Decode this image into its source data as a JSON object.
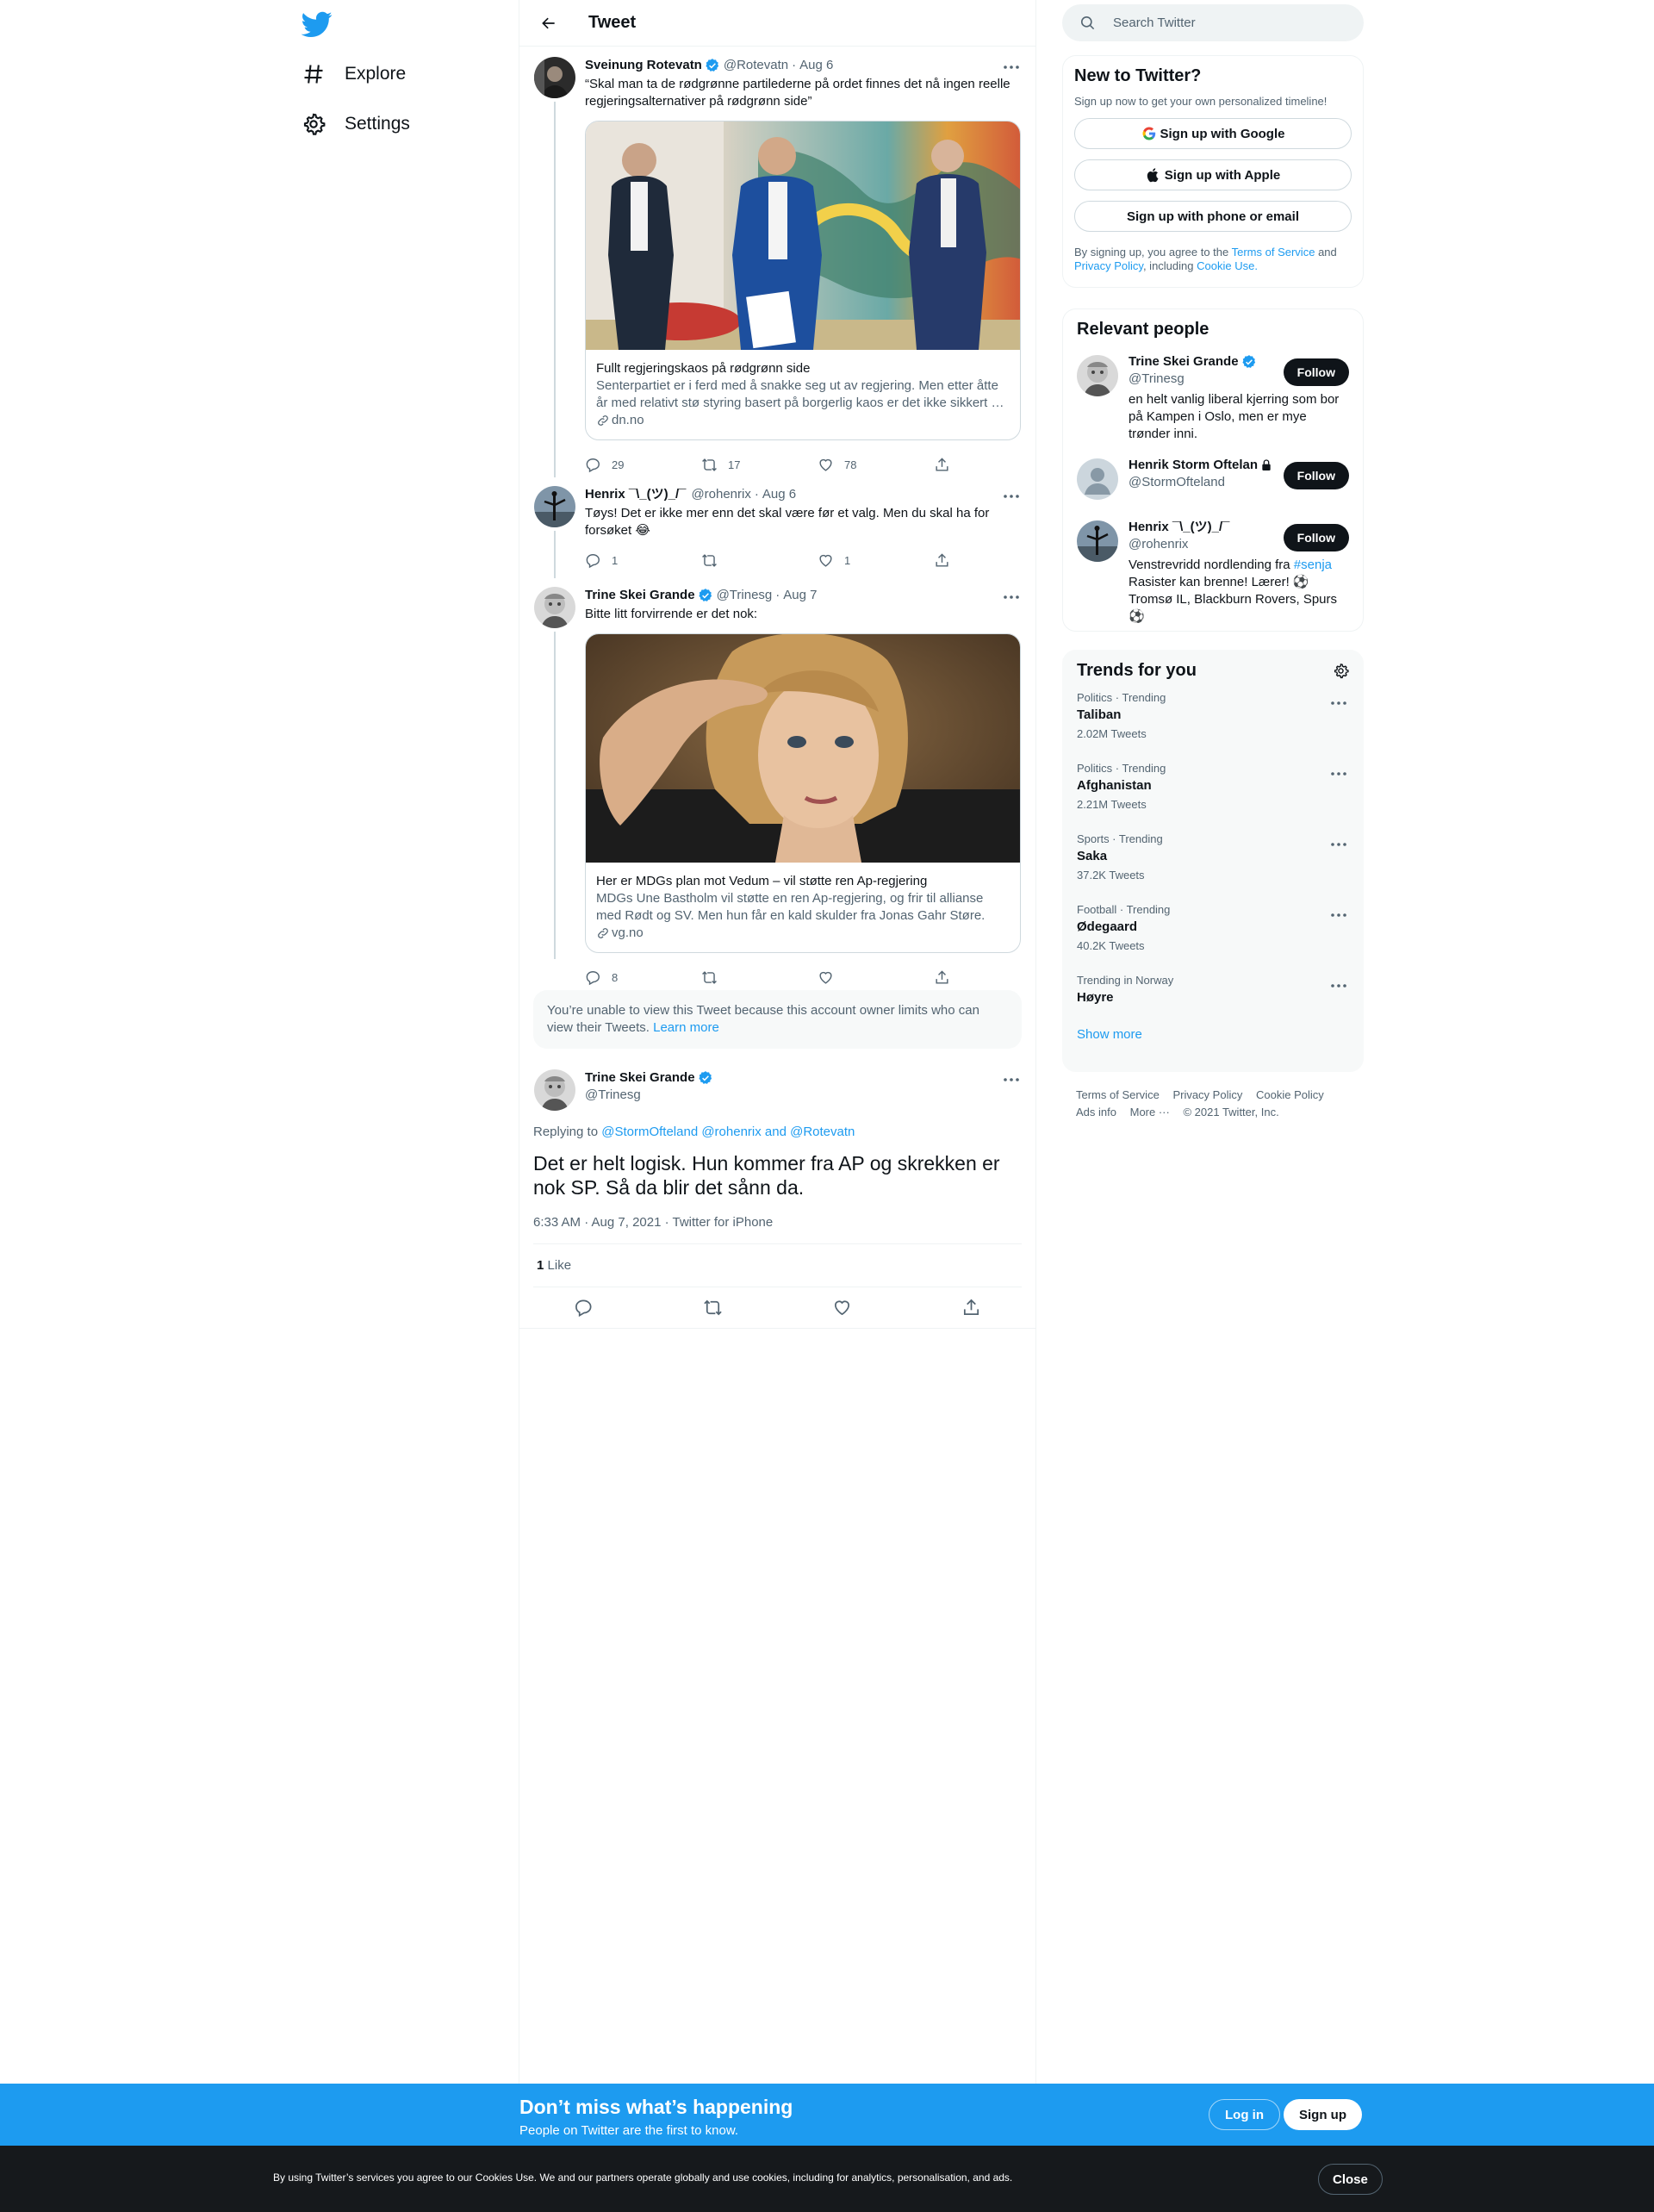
{
  "colors": {
    "accent": "#1d9bf0",
    "text": "#0f1419",
    "secondary": "#536471"
  },
  "nav": {
    "explore": "Explore",
    "settings": "Settings"
  },
  "header": {
    "title": "Tweet"
  },
  "tweets": [
    {
      "name": "Sveinung Rotevatn",
      "handle": "@Rotevatn",
      "sep": "·",
      "date": "Aug 6",
      "text": "“Skal man ta de rødgrønne partilederne på ordet finnes det nå ingen reelle regjeringsalternativer på rødgrønn side”",
      "card": {
        "title": "Fullt regjeringskaos på rødgrønn side",
        "desc": "Senterpartiet er i ferd med å snakke seg ut av regjering. Men etter åtte år med relativt stø styring basert på borgerlig kaos er det ikke sikkert at det vil vare.",
        "domain": "dn.no"
      },
      "replies": "29",
      "retweets": "17",
      "likes": "78"
    },
    {
      "name": "Henrix ¯\\_(ツ)_/¯",
      "handle": "@rohenrix",
      "sep": "·",
      "date": "Aug 6",
      "text": "Tøys! Det er ikke mer enn det skal være før et valg. Men du skal ha for forsøket 😂",
      "replies": "1",
      "retweets": "",
      "likes": "1"
    },
    {
      "name": "Trine Skei Grande",
      "handle": "@Trinesg",
      "sep": "·",
      "date": "Aug 7",
      "text": "Bitte litt forvirrende er det nok:",
      "card": {
        "title": "Her er MDGs plan mot Vedum – vil støtte ren Ap-regjering",
        "desc": "MDGs Une Bastholm vil støtte en ren Ap-regjering, og frir til allianse med Rødt og SV. Men hun får en kald skulder fra Jonas Gahr Støre.",
        "domain": "vg.no"
      },
      "replies": "8",
      "retweets": "",
      "likes": ""
    }
  ],
  "limited": {
    "text": "You’re unable to view this Tweet because this account owner limits who can view their Tweets.",
    "link": "Learn more"
  },
  "focus": {
    "name": "Trine Skei Grande",
    "handle": "@Trinesg",
    "replying_label": "Replying to",
    "replying_to": "@StormOfteland @rohenrix and @Rotevatn",
    "text": "Det er helt logisk. Hun kommer fra AP og skrekken er nok SP. Så da blir det sånn da.",
    "meta": "6:33 AM · Aug 7, 2021 · Twitter for iPhone",
    "like_count": "1",
    "like_label": "Like"
  },
  "search": {
    "placeholder": "Search Twitter"
  },
  "signup": {
    "title": "New to Twitter?",
    "sub": "Sign up now to get your own personalized timeline!",
    "google": "Sign up with Google",
    "apple": "Sign up with Apple",
    "phone": "Sign up with phone or email",
    "terms_pre": "By signing up, you agree to the",
    "terms_link": "Terms of Service",
    "terms_and": "and",
    "privacy_link": "Privacy Policy",
    "terms_mid": ", including",
    "cookie_link": "Cookie Use."
  },
  "people": {
    "title": "Relevant people",
    "follow_label": "Follow",
    "items": [
      {
        "name": "Trine Skei Grande",
        "handle": "@Trinesg",
        "bio": "en helt vanlig liberal kjerring som bor på Kampen i Oslo, men er mye trønder inni."
      },
      {
        "name": "Henrik Storm Oftelan",
        "handle": "@StormOfteland",
        "bio": ""
      },
      {
        "name": "Henrix ¯\\_(ツ)_/¯",
        "handle": "@rohenrix",
        "bio_pre": "Venstrevridd nordlending fra",
        "bio_tag": "#senja",
        "bio_post": "Rasister kan brenne! Lærer! ⚽Tromsø IL, Blackburn Rovers, Spurs ⚽"
      }
    ]
  },
  "trends": {
    "title": "Trends for you",
    "items": [
      {
        "meta": "Politics · Trending",
        "name": "Taliban",
        "count": "2.02M Tweets"
      },
      {
        "meta": "Politics · Trending",
        "name": "Afghanistan",
        "count": "2.21M Tweets"
      },
      {
        "meta": "Sports · Trending",
        "name": "Saka",
        "count": "37.2K Tweets"
      },
      {
        "meta": "Football · Trending",
        "name": "Ødegaard",
        "count": "40.2K Tweets"
      },
      {
        "meta": "Trending in Norway",
        "name": "Høyre",
        "count": ""
      }
    ],
    "show_more": "Show more"
  },
  "footer": {
    "terms": "Terms of Service",
    "privacy": "Privacy Policy",
    "cookie": "Cookie Policy",
    "ads": "Ads info",
    "more": "More ···",
    "copyright": "© 2021 Twitter, Inc."
  },
  "bottom": {
    "title": "Don’t miss what’s happening",
    "sub": "People on Twitter are the first to know.",
    "login": "Log in",
    "signup": "Sign up"
  },
  "cookie": {
    "text": "By using Twitter’s services you agree to our Cookies Use. We and our partners operate globally and use cookies, including for analytics, personalisation, and ads.",
    "close": "Close"
  }
}
